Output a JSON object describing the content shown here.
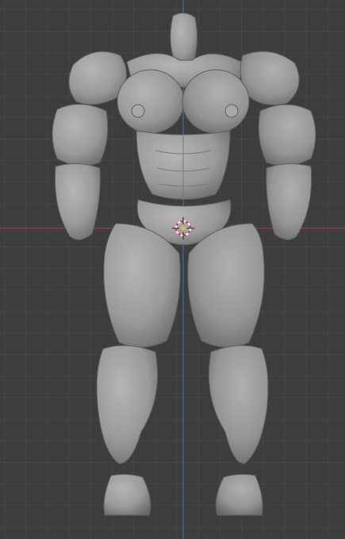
{
  "app": "3D viewport",
  "viewport": {
    "background": "#3d3d3d",
    "grid_color": "#4a4a4a",
    "x_axis_color": "#9a3a48",
    "z_axis_color": "#3d6fa6",
    "mesh_color": "#9c9c9c",
    "mesh_shadow": "#6b6b6b"
  },
  "scene": {
    "object_type": "sculpted humanoid body mesh",
    "parts": [
      "head",
      "shoulders",
      "chest",
      "abdomen",
      "arms",
      "pelvis",
      "thighs",
      "calves",
      "feet"
    ]
  },
  "cursor": {
    "icon": "3d-cursor-icon"
  }
}
